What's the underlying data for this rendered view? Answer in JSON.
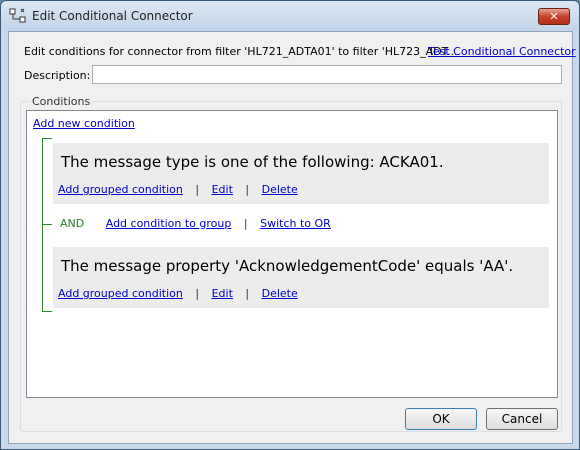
{
  "window": {
    "title": "Edit Conditional Connector",
    "close_glyph": "✕"
  },
  "header": {
    "description_text": "Edit conditions for connector from filter 'HL721_ADTA01' to filter 'HL723_ADT...",
    "test_link": "Test Conditional Connector"
  },
  "description": {
    "label": "Description:",
    "value": ""
  },
  "conditions": {
    "group_title": "Conditions",
    "add_new_label": "Add new condition",
    "items": [
      {
        "text": "The message type is one of the following: ACKA01.",
        "add_grouped": "Add grouped condition",
        "edit": "Edit",
        "delete": "Delete"
      },
      {
        "text": "The message property 'AcknowledgementCode' equals 'AA'.",
        "add_grouped": "Add grouped condition",
        "edit": "Edit",
        "delete": "Delete"
      }
    ],
    "operator_row": {
      "operator": "AND",
      "add_to_group": "Add condition to group",
      "switch": "Switch to OR"
    },
    "separator": "|"
  },
  "buttons": {
    "ok": "OK",
    "cancel": "Cancel"
  },
  "colors": {
    "link": "#0000cc",
    "bracket": "#2e8b2e",
    "close_button": "#c8432a"
  },
  "icons": {
    "title_icon": "connector-icon"
  }
}
